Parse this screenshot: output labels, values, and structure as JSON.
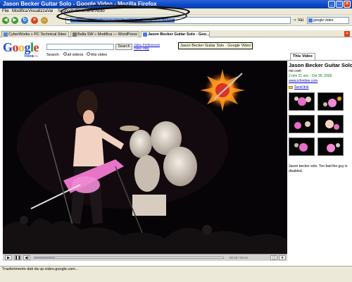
{
  "window": {
    "title": "Jason Becker Guitar Solo - Google Video - Mozilla Firefox"
  },
  "menu": [
    "File",
    "Modifica",
    "Visualizza",
    "Vai",
    "Segnalibri",
    "Strumenti",
    "Aiuto"
  ],
  "navbar": {
    "url": "http://video.google.com/videoplay?docid=6341116702389674250",
    "go_label": "Vai",
    "search_value": "google video"
  },
  "tabs": [
    {
      "label": "CyberWorks » PC Technical Sites"
    },
    {
      "label": "Balla SW » Modifica — WordPress"
    },
    {
      "label": "Jason Becker Guitar Solo - Goo..."
    }
  ],
  "page": {
    "logo_letters": [
      "G",
      "o",
      "o",
      "g",
      "l",
      "e"
    ],
    "logo_sub": "Video",
    "logo_beta": "BETA",
    "search_button": "Search",
    "prefs": [
      "Video Preferences",
      "Video Help"
    ],
    "tooltip": "Jason Becker Guitar Solo - Google Video",
    "search_label": "Search:",
    "search_options": [
      "all videos",
      "this video"
    ],
    "controls": {
      "play": "▶",
      "pause": "❚❚",
      "volume": "◀)",
      "fullscreen": "▢",
      "time": "00:15 / 02:21",
      "progress": 0.11
    }
  },
  "sidebar": {
    "tab_label": "This Video",
    "title": "Jason Becker Guitar Solo",
    "source": "me.com",
    "meta": "2 min 21 sec - Oct 30, 2005",
    "site": "www.icfonline.com",
    "send_link": "Send link",
    "description": "Jason becker solo. Too bad the guy is disabled."
  },
  "status": "Trasferimento dati da vp.video.google.com..."
}
